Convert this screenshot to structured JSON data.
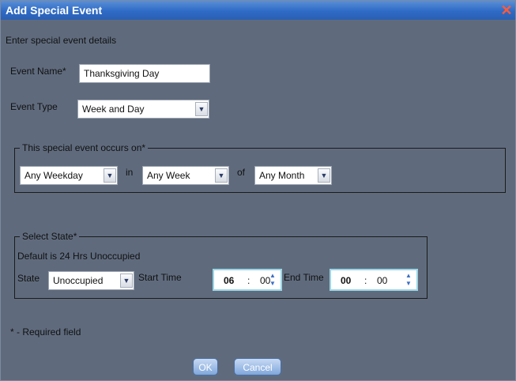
{
  "dialog": {
    "title": "Add Special Event",
    "close_glyph": "✕",
    "instruction": "Enter special event details",
    "event_name_label": "Event Name*",
    "event_name_value": "Thanksgiving Day",
    "event_type_label": "Event Type",
    "event_type_value": "Week and Day",
    "occurs_legend": "This special event occurs on*",
    "weekday_value": "Any Weekday",
    "in_label": "in",
    "week_value": "Any Week",
    "of_label": "of",
    "month_value": "Any Month",
    "state_legend": "Select State*",
    "default_note": "Default is 24 Hrs Unoccupied",
    "state_label": "State",
    "state_value": "Unoccupied",
    "start_time_label": "Start Time",
    "start_hh": "06",
    "start_mm": "00",
    "end_time_label": "End Time",
    "end_hh": "00",
    "end_mm": "00",
    "time_sep": ":",
    "required_note": "* - Required field",
    "ok_label": "OK",
    "cancel_label": "Cancel"
  },
  "icons": {
    "dropdown": "chevron-down-icon",
    "spinner": "up-down-spinner-icon",
    "close": "close-icon"
  },
  "colors": {
    "dialog_bg": "#5f6b7d",
    "titlebar": "#2e6bc6",
    "time_border": "#9bd6e6",
    "button": "#7fa7dc"
  }
}
